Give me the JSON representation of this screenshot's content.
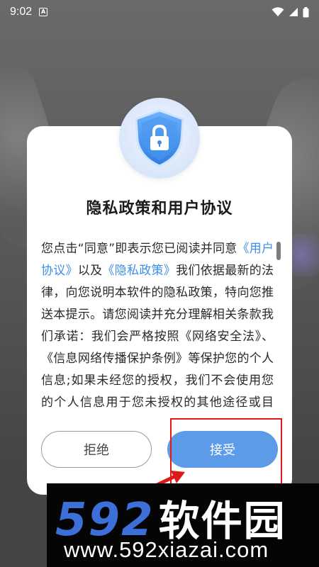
{
  "status_bar": {
    "time": "9:02",
    "notification_icon_text": "A",
    "icons": [
      "wifi-icon",
      "signal-icon",
      "battery-icon"
    ]
  },
  "dialog": {
    "title": "隐私政策和用户协议",
    "body": {
      "p1_before": "您点击“同意”即表示您已阅读并同意",
      "link_user_agreement": "《用户协议》",
      "p1_mid": "以及",
      "link_privacy_policy": "《隐私政策》",
      "p1_after": "我们依据最新的法律，向您说明本软件的隐私政策，特向您推送本提示。请您阅读并充分理解相关条款我们承诺：我们会严格按照《网络安全法》、《信息网络传播保护条例》等保护您的个人信息;如果未经您的授权，我们不会使用您的个人信息用于您未授权的其他途径或目的。"
    },
    "reject_label": "拒绝",
    "accept_label": "接受"
  },
  "watermark": {
    "brand_number": "592",
    "brand_text": "软件园",
    "url": "www.592xiazai.com"
  },
  "colors": {
    "accent": "#5b9be8",
    "link": "#3f8ee8",
    "annotation": "#e01818",
    "watermark_blue": "#3d6fd8"
  }
}
